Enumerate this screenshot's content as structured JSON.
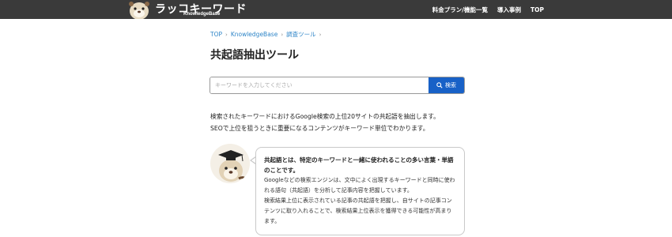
{
  "header": {
    "logo_title": "ラッコキーワード",
    "logo_subtitle": "KnowledgeBase",
    "nav": [
      "料金プラン/機能一覧",
      "導入事例",
      "TOP"
    ]
  },
  "breadcrumb": [
    "TOP",
    "KnowledgeBase",
    "調査ツール"
  ],
  "page_title": "共起語抽出ツール",
  "search": {
    "placeholder": "キーワードを入力してください",
    "button_label": "検索"
  },
  "description": [
    "検索されたキーワードにおけるGoogle検索の上位20サイトの共起語を抽出します。",
    "SEOで上位を狙うときに重要になるコンテンツがキーワード単位でわかります。"
  ],
  "info_card": {
    "heading": "共起語とは、特定のキーワードと一緒に使われることの多い言葉・単語のことです。",
    "body": [
      "Googleなどの検索エンジンは、文中によく出現するキーワードと同時に使われる語句（共起語）を分析して記事内容を把握しています。",
      "検索結果上位に表示されている記事の共起語を把握し、自サイトの記事コンテンツに取り入れることで、検索結果上位表示を獲得できる可能性が高まります。"
    ]
  },
  "colors": {
    "header_bg": "#3a3a3a",
    "link": "#2f86c8",
    "button": "#1861c7"
  }
}
